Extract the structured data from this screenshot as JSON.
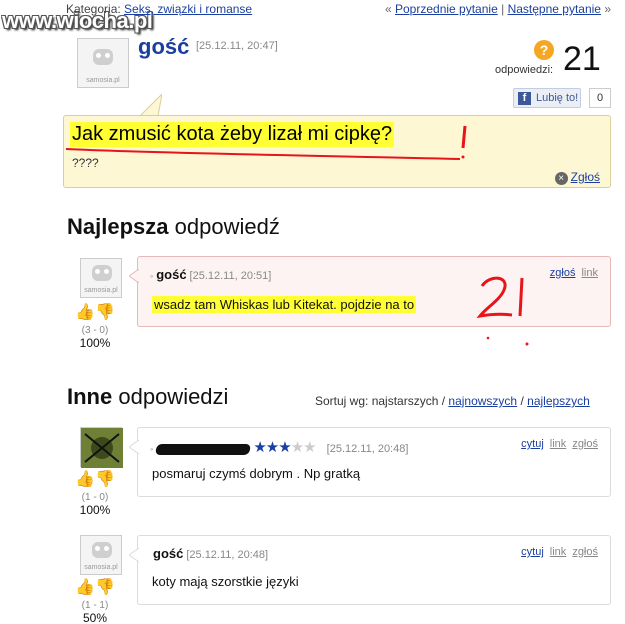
{
  "watermark": "www.wiocha.pl",
  "topbar": {
    "category_label": "Kategoria:",
    "category_link": "Seks, związki i romanse",
    "prev_link": "Poprzednie pytanie",
    "next_link": "Następne pytanie",
    "prev_arrow": "«",
    "separator": "|",
    "next_arrow": "»"
  },
  "question": {
    "author": "gość",
    "timestamp": "[25.12.11, 20:47]",
    "answers_label": "odpowiedzi:",
    "answers_count": "21",
    "like_label": "Lubię to!",
    "like_count": "0",
    "title": "Jak zmusić kota żeby lizał mi cipkę?",
    "body": "????",
    "report_label": "Zgłoś",
    "avatar_caption": "samosia.pl"
  },
  "best": {
    "heading_bold": "Najlepsza",
    "heading_rest": "odpowiedź",
    "author": "gość",
    "timestamp": "[25.12.11, 20:51]",
    "text": "wsadz tam Whiskas lub Kitekat. pojdzie na to",
    "report_link": "zgłoś",
    "link_label": "link",
    "score": "(3 - 0)",
    "percent": "100%"
  },
  "others": {
    "heading_bold": "Inne",
    "heading_rest": "odpowiedzi",
    "sort_label": "Sortuj wg: najstarszych /",
    "sort_newest": "najnowszych",
    "sort_sep": "/",
    "sort_best": "najlepszych",
    "items": [
      {
        "timestamp": "[25.12.11, 20:48]",
        "text": "posmaruj czymś dobrym . Np gratką",
        "stars": 3,
        "score": "(1 - 0)",
        "percent": "100%",
        "quote_link": "cytuj",
        "link_label": "link",
        "report_link": "zgłoś"
      },
      {
        "author": "gość",
        "timestamp": "[25.12.11, 20:48]",
        "text": "koty mają szorstkie języki",
        "score": "(1 - 1)",
        "percent": "50%",
        "quote_link": "cytuj",
        "link_label": "link",
        "report_link": "zgłoś"
      }
    ]
  },
  "colors": {
    "link": "#1b3fa0",
    "highlight": "#ffff33",
    "question_bg": "#fdf7d4",
    "best_border": "#e6b8b8",
    "annotation_red": "#e8141a"
  }
}
